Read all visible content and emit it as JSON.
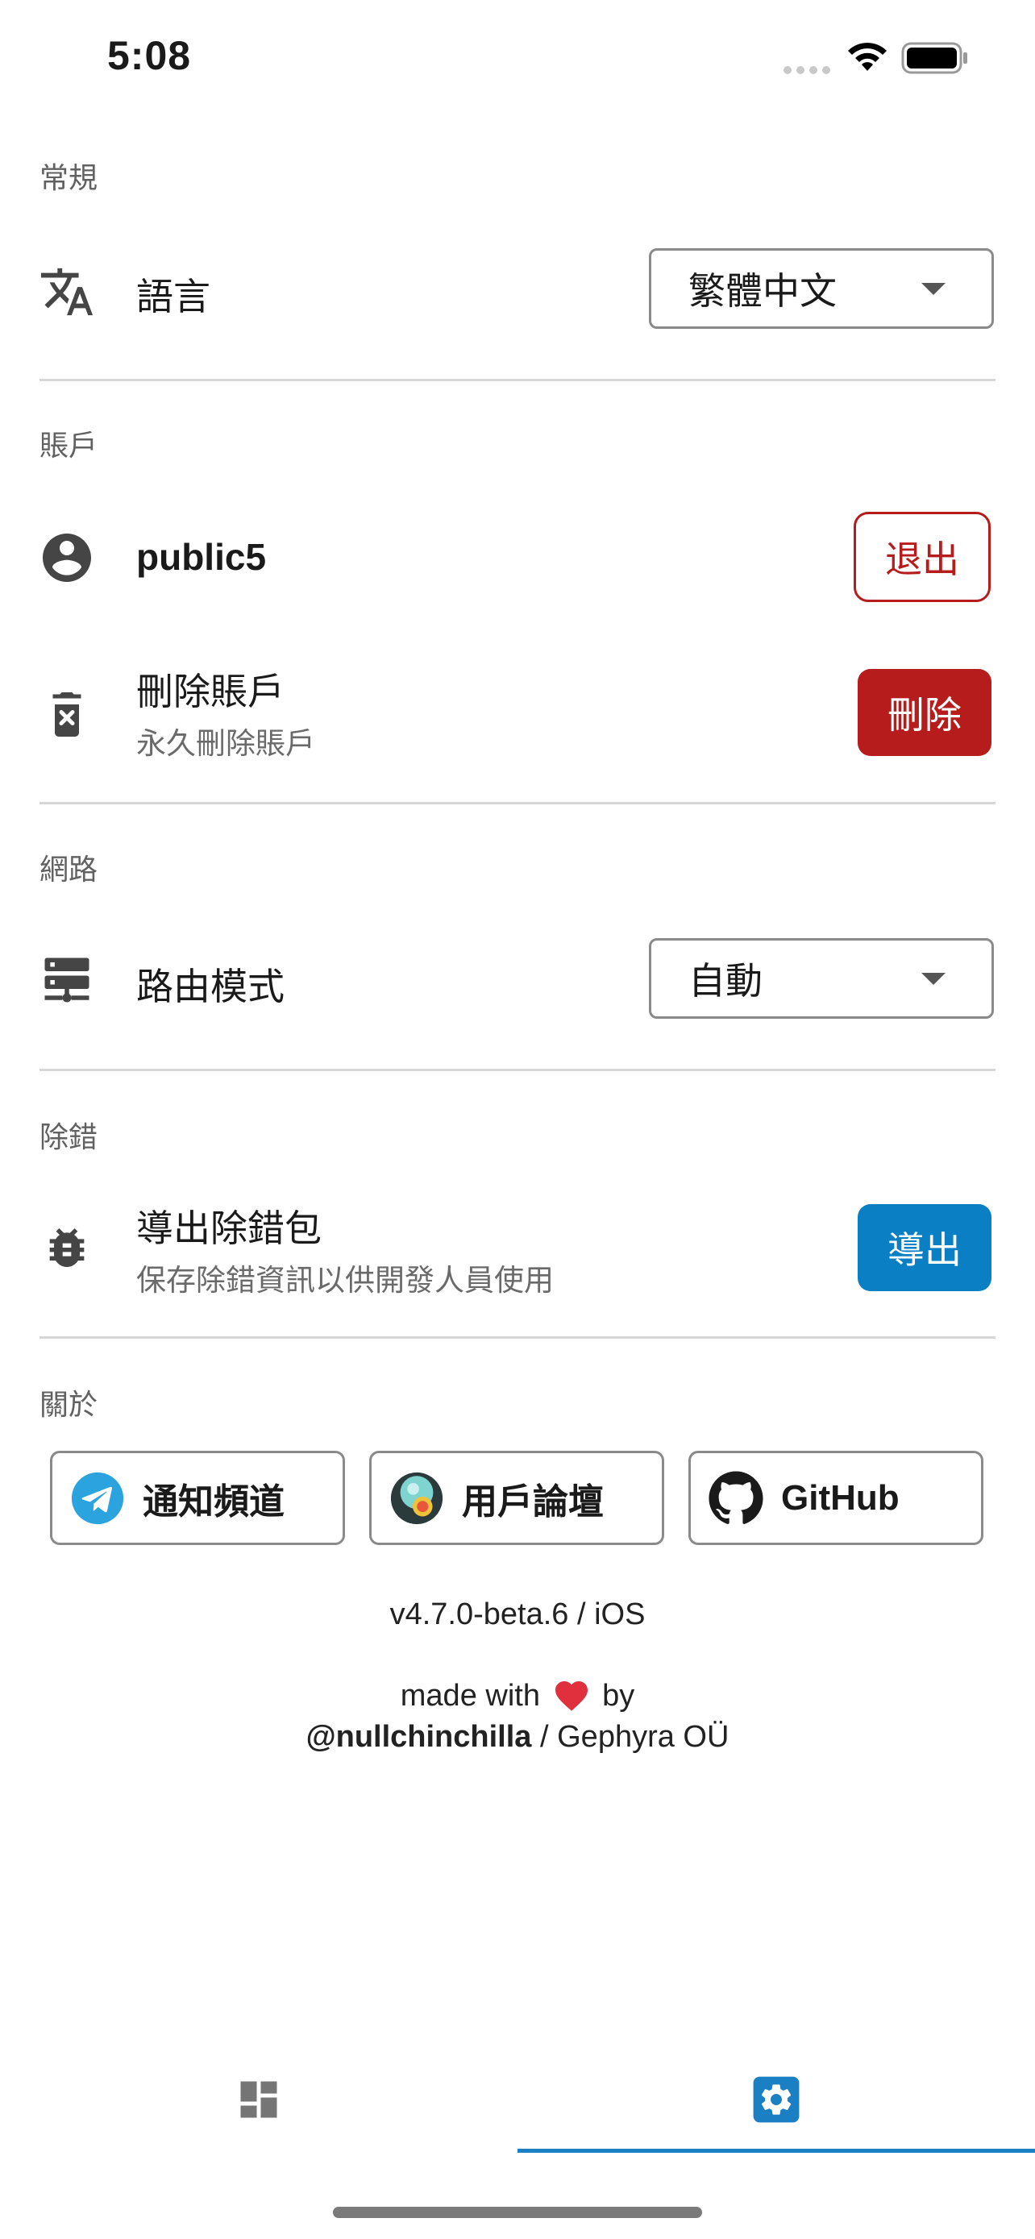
{
  "status_bar": {
    "time": "5:08"
  },
  "sections": {
    "general": {
      "title": "常規",
      "language": {
        "label": "語言",
        "selected": "繁體中文",
        "icon": "translate-icon"
      }
    },
    "account": {
      "title": "賬戶",
      "user": {
        "name": "public5",
        "logout_label": "退出",
        "icon": "account-circle-icon"
      },
      "delete": {
        "label": "刪除賬戶",
        "sublabel": "永久刪除賬戶",
        "button_label": "刪除",
        "icon": "trash-icon"
      }
    },
    "network": {
      "title": "網路",
      "routing": {
        "label": "路由模式",
        "selected": "自動",
        "icon": "server-icon"
      }
    },
    "debug": {
      "title": "除錯",
      "export": {
        "label": "導出除錯包",
        "sublabel": "保存除錯資訊以供開發人員使用",
        "button_label": "導出",
        "icon": "bug-icon"
      }
    },
    "about": {
      "title": "關於",
      "links": [
        {
          "label": "通知頻道",
          "icon": "telegram-icon"
        },
        {
          "label": "用戶論壇",
          "icon": "forum-icon"
        },
        {
          "label": "GitHub",
          "icon": "github-icon"
        }
      ],
      "version": "v4.7.0-beta.6 / iOS",
      "made_with": "made with",
      "by": "by",
      "author_handle": "@nullchinchilla",
      "author_separator": " / ",
      "author_company": "Gephyra OÜ"
    }
  },
  "tabs": [
    {
      "name": "dashboard",
      "icon": "dashboard-icon",
      "active": false
    },
    {
      "name": "settings",
      "icon": "gear-icon",
      "active": true
    }
  ],
  "colors": {
    "danger": "#b71c1c",
    "primary": "#0a7fc4",
    "heart": "#e0303e"
  }
}
